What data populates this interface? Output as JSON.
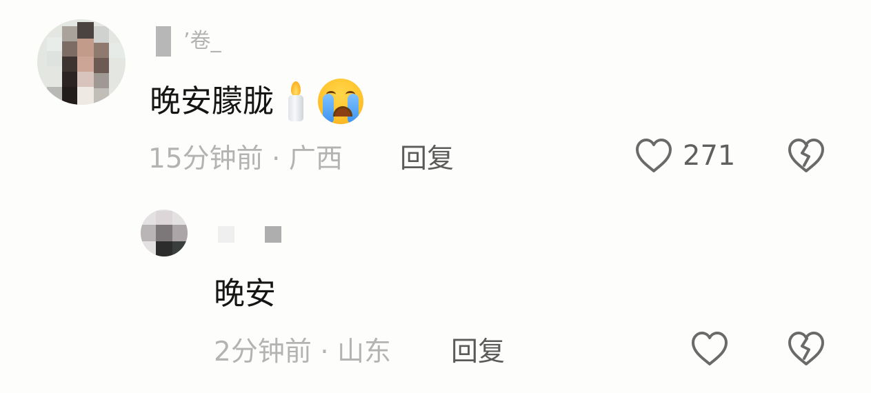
{
  "comment": {
    "username_fragment": "’卷_",
    "text": "晚安朦胧",
    "emojis": [
      "candle-emoji",
      "loudly-crying-face-emoji"
    ],
    "meta": "15分钟前 · 广西",
    "reply_label": "回复",
    "like_count": "271"
  },
  "reply": {
    "text": "晚安",
    "meta": "2分钟前 · 山东",
    "reply_label": "回复"
  },
  "colors": {
    "background": "#fdfdfb",
    "text_primary": "#151515",
    "text_secondary": "#b3b3b3",
    "reply_label": "#5a5a5a",
    "icon": "#6a6a6a"
  },
  "icons": {
    "like": "heart-outline-icon",
    "dislike": "broken-heart-outline-icon"
  }
}
